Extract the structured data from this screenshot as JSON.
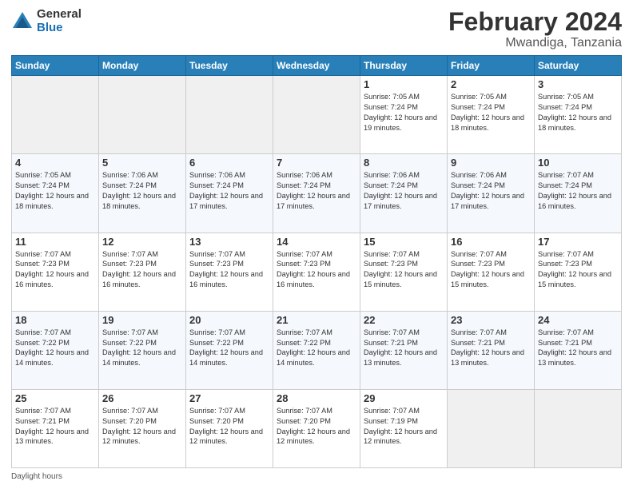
{
  "logo": {
    "general": "General",
    "blue": "Blue"
  },
  "header": {
    "month": "February 2024",
    "location": "Mwandiga, Tanzania"
  },
  "days_of_week": [
    "Sunday",
    "Monday",
    "Tuesday",
    "Wednesday",
    "Thursday",
    "Friday",
    "Saturday"
  ],
  "footer": {
    "label": "Daylight hours"
  },
  "weeks": [
    [
      {
        "day": "",
        "info": ""
      },
      {
        "day": "",
        "info": ""
      },
      {
        "day": "",
        "info": ""
      },
      {
        "day": "",
        "info": ""
      },
      {
        "day": "1",
        "info": "Sunrise: 7:05 AM\nSunset: 7:24 PM\nDaylight: 12 hours\nand 19 minutes."
      },
      {
        "day": "2",
        "info": "Sunrise: 7:05 AM\nSunset: 7:24 PM\nDaylight: 12 hours\nand 18 minutes."
      },
      {
        "day": "3",
        "info": "Sunrise: 7:05 AM\nSunset: 7:24 PM\nDaylight: 12 hours\nand 18 minutes."
      }
    ],
    [
      {
        "day": "4",
        "info": "Sunrise: 7:05 AM\nSunset: 7:24 PM\nDaylight: 12 hours\nand 18 minutes."
      },
      {
        "day": "5",
        "info": "Sunrise: 7:06 AM\nSunset: 7:24 PM\nDaylight: 12 hours\nand 18 minutes."
      },
      {
        "day": "6",
        "info": "Sunrise: 7:06 AM\nSunset: 7:24 PM\nDaylight: 12 hours\nand 17 minutes."
      },
      {
        "day": "7",
        "info": "Sunrise: 7:06 AM\nSunset: 7:24 PM\nDaylight: 12 hours\nand 17 minutes."
      },
      {
        "day": "8",
        "info": "Sunrise: 7:06 AM\nSunset: 7:24 PM\nDaylight: 12 hours\nand 17 minutes."
      },
      {
        "day": "9",
        "info": "Sunrise: 7:06 AM\nSunset: 7:24 PM\nDaylight: 12 hours\nand 17 minutes."
      },
      {
        "day": "10",
        "info": "Sunrise: 7:07 AM\nSunset: 7:24 PM\nDaylight: 12 hours\nand 16 minutes."
      }
    ],
    [
      {
        "day": "11",
        "info": "Sunrise: 7:07 AM\nSunset: 7:23 PM\nDaylight: 12 hours\nand 16 minutes."
      },
      {
        "day": "12",
        "info": "Sunrise: 7:07 AM\nSunset: 7:23 PM\nDaylight: 12 hours\nand 16 minutes."
      },
      {
        "day": "13",
        "info": "Sunrise: 7:07 AM\nSunset: 7:23 PM\nDaylight: 12 hours\nand 16 minutes."
      },
      {
        "day": "14",
        "info": "Sunrise: 7:07 AM\nSunset: 7:23 PM\nDaylight: 12 hours\nand 16 minutes."
      },
      {
        "day": "15",
        "info": "Sunrise: 7:07 AM\nSunset: 7:23 PM\nDaylight: 12 hours\nand 15 minutes."
      },
      {
        "day": "16",
        "info": "Sunrise: 7:07 AM\nSunset: 7:23 PM\nDaylight: 12 hours\nand 15 minutes."
      },
      {
        "day": "17",
        "info": "Sunrise: 7:07 AM\nSunset: 7:23 PM\nDaylight: 12 hours\nand 15 minutes."
      }
    ],
    [
      {
        "day": "18",
        "info": "Sunrise: 7:07 AM\nSunset: 7:22 PM\nDaylight: 12 hours\nand 14 minutes."
      },
      {
        "day": "19",
        "info": "Sunrise: 7:07 AM\nSunset: 7:22 PM\nDaylight: 12 hours\nand 14 minutes."
      },
      {
        "day": "20",
        "info": "Sunrise: 7:07 AM\nSunset: 7:22 PM\nDaylight: 12 hours\nand 14 minutes."
      },
      {
        "day": "21",
        "info": "Sunrise: 7:07 AM\nSunset: 7:22 PM\nDaylight: 12 hours\nand 14 minutes."
      },
      {
        "day": "22",
        "info": "Sunrise: 7:07 AM\nSunset: 7:21 PM\nDaylight: 12 hours\nand 13 minutes."
      },
      {
        "day": "23",
        "info": "Sunrise: 7:07 AM\nSunset: 7:21 PM\nDaylight: 12 hours\nand 13 minutes."
      },
      {
        "day": "24",
        "info": "Sunrise: 7:07 AM\nSunset: 7:21 PM\nDaylight: 12 hours\nand 13 minutes."
      }
    ],
    [
      {
        "day": "25",
        "info": "Sunrise: 7:07 AM\nSunset: 7:21 PM\nDaylight: 12 hours\nand 13 minutes."
      },
      {
        "day": "26",
        "info": "Sunrise: 7:07 AM\nSunset: 7:20 PM\nDaylight: 12 hours\nand 12 minutes."
      },
      {
        "day": "27",
        "info": "Sunrise: 7:07 AM\nSunset: 7:20 PM\nDaylight: 12 hours\nand 12 minutes."
      },
      {
        "day": "28",
        "info": "Sunrise: 7:07 AM\nSunset: 7:20 PM\nDaylight: 12 hours\nand 12 minutes."
      },
      {
        "day": "29",
        "info": "Sunrise: 7:07 AM\nSunset: 7:19 PM\nDaylight: 12 hours\nand 12 minutes."
      },
      {
        "day": "",
        "info": ""
      },
      {
        "day": "",
        "info": ""
      }
    ]
  ]
}
